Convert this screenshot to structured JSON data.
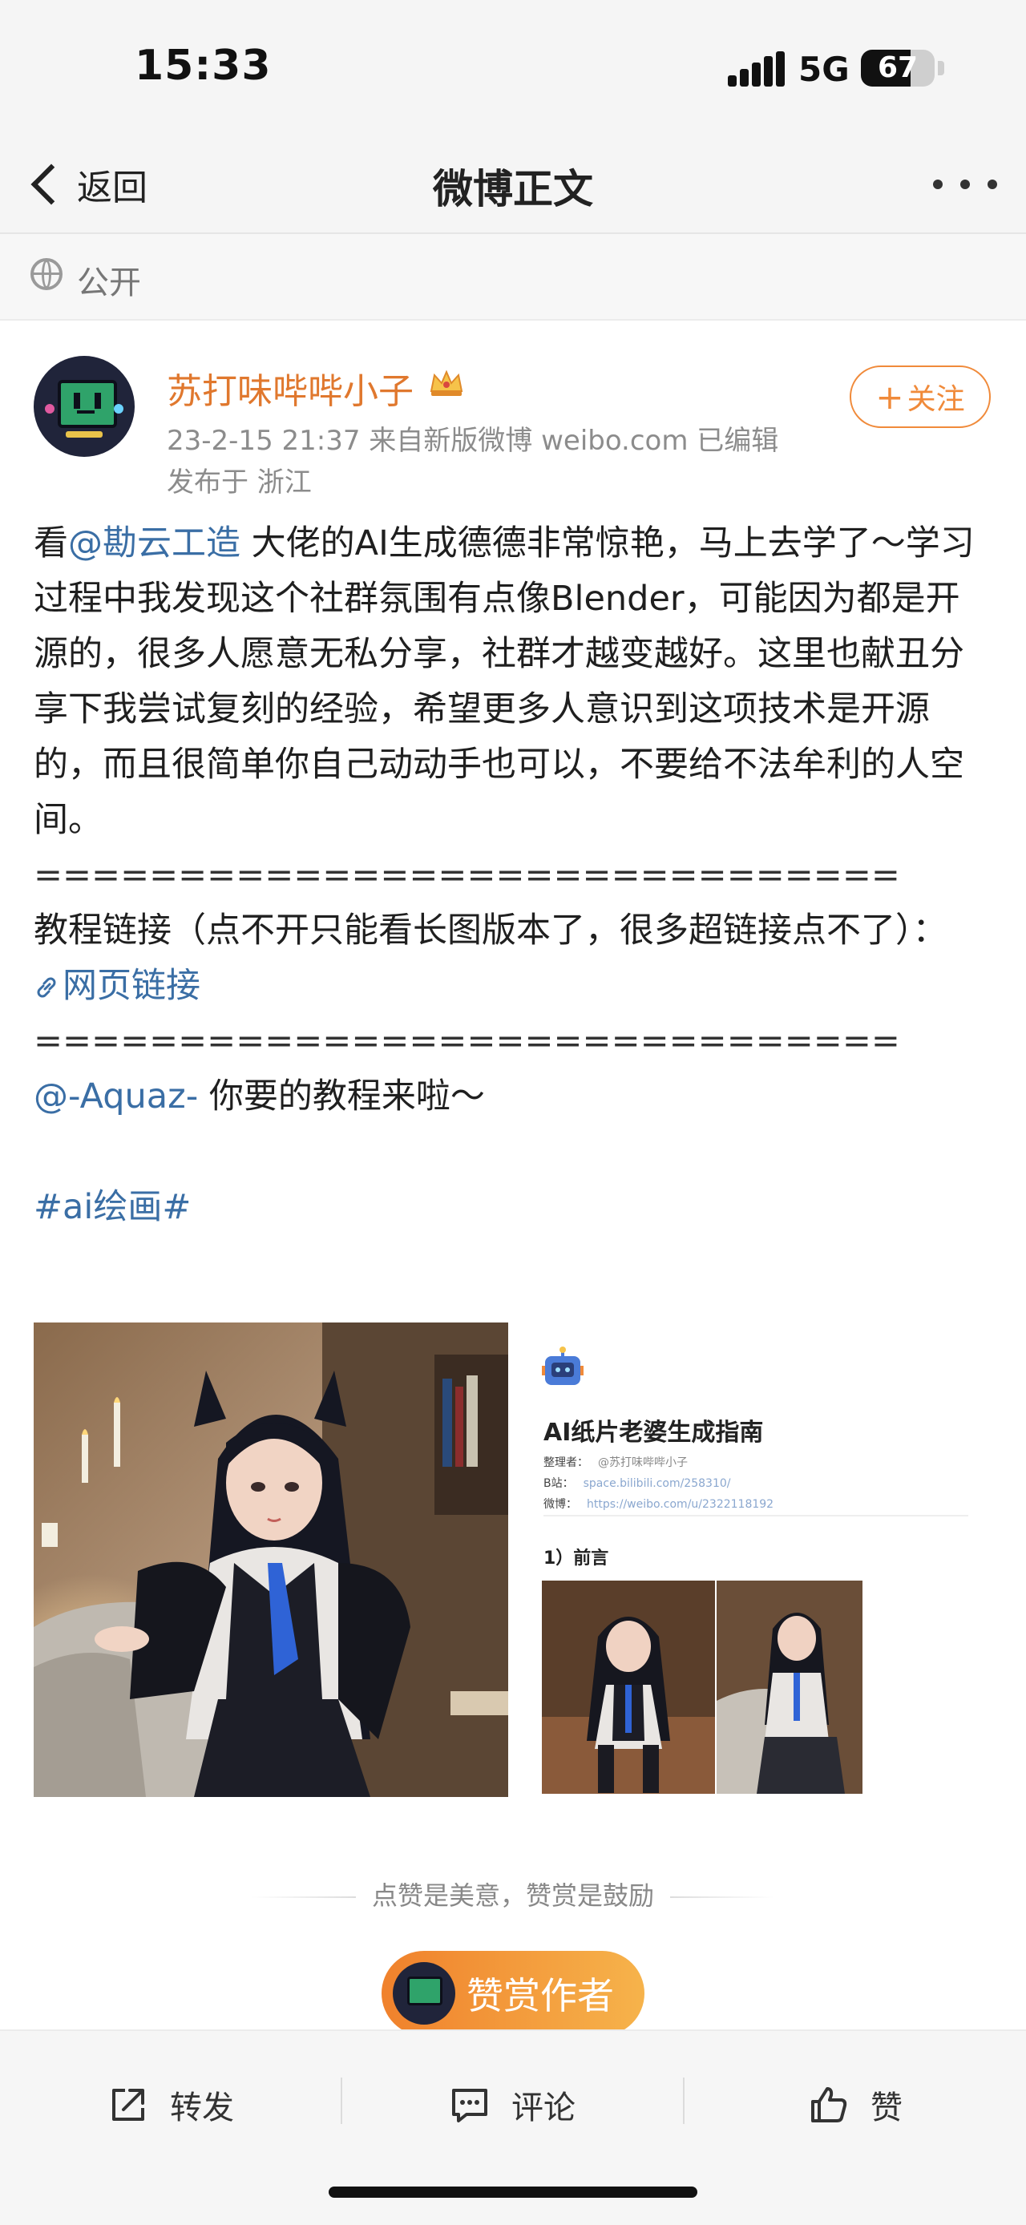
{
  "status_bar": {
    "time": "15:33",
    "network": "5G",
    "battery": "67",
    "battery_level": 0.67
  },
  "nav": {
    "back_label": "返回",
    "title": "微博正文"
  },
  "visibility": {
    "label": "公开"
  },
  "author": {
    "name": "苏打味哔哔小子",
    "meta": "23-2-15 21:37  来自新版微博 weibo.com  已编辑",
    "location": "发布于 浙江",
    "follow_label": "关注",
    "follow_plus": "+"
  },
  "post": {
    "p1_prefix": "看",
    "p1_mention": "@勘云工造",
    "p1_rest": " 大佬的AI生成德德非常惊艳，马上去学了～学习过程中我发现这个社群氛围有点像Blender，可能因为都是开源的，很多人愿意无私分享，社群才越变越好。这里也献丑分享下我尝试复刻的经验，希望更多人意识到这项技术是开源的，而且很简单你自己动动手也可以，不要给不法牟利的人空间。",
    "separator1": "==============================",
    "tutorial_note": "教程链接（点不开只能看长图版本了，很多超链接点不了）：",
    "web_link": "网页链接",
    "separator2": "==============================",
    "mention2": "@-Aquaz-",
    "mention2_rest": " 你要的教程来啦～",
    "hashtag": "#ai绘画#"
  },
  "doc_image": {
    "title": "AI纸片老婆生成指南",
    "organizer_label": "整理者：",
    "organizer": "@苏打味哔哔小子",
    "bili_label": "B站：",
    "bili": "space.bilibili.com/258310/",
    "weibo_label": "微博：",
    "weibo": "https://weibo.com/u/2322118192",
    "section": "1）前言"
  },
  "reward": {
    "hint": "点赞是美意，赞赏是鼓励",
    "button_label": "赞赏作者"
  },
  "bottom_bar": {
    "repost": "转发",
    "comment": "评论",
    "like": "赞"
  },
  "colors": {
    "accent_orange": "#f08a3a",
    "link_blue": "#3a6ea5",
    "meta_gray": "#8c8c8c"
  }
}
